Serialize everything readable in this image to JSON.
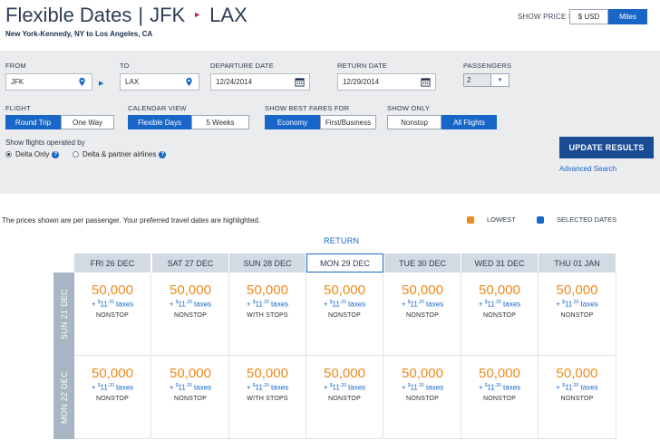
{
  "header": {
    "title_a": "Flexible Dates",
    "title_sep": "|",
    "origin": "JFK",
    "destination": "LAX",
    "route": "New York-Kennedy, NY to Los Angeles, CA",
    "show_price_in": "SHOW PRICE IN",
    "usd_label": "$ USD",
    "miles_label": "Miles"
  },
  "search": {
    "from_label": "FROM",
    "from_value": "JFK",
    "to_label": "TO",
    "to_value": "LAX",
    "depart_label": "DEPARTURE DATE",
    "depart_value": "12/24/2014",
    "return_label": "RETURN DATE",
    "return_value": "12/29/2014",
    "passengers_label": "PASSENGERS",
    "passengers_value": "2",
    "flight_label": "FLIGHT",
    "flight_opts": [
      "Round Trip",
      "One Way"
    ],
    "calendar_label": "CALENDAR VIEW",
    "calendar_opts": [
      "Flexible Days",
      "5 Weeks"
    ],
    "fares_label": "SHOW BEST FARES FOR",
    "fares_opts": [
      "Economy",
      "First/Business"
    ],
    "only_label": "SHOW ONLY",
    "only_opts": [
      "Nonstop",
      "All Flights"
    ],
    "operated_label": "Show flights operated by",
    "op_delta": "Delta Only",
    "op_partner": "Delta & partner airlines",
    "update_btn": "UPDATE RESULTS",
    "advanced": "Advanced Search"
  },
  "info": {
    "note": "The prices shown are per passenger. Your preferred travel dates are highlighted.",
    "lowest": "LOWEST",
    "selected": "SELECTED DATES",
    "return_hdr": "RETURN",
    "colors": {
      "lowest": "#f08a1e",
      "selected": "#1866c7"
    }
  },
  "grid": {
    "columns": [
      "FRI 26 DEC",
      "SAT 27 DEC",
      "SUN 28 DEC",
      "MON 29 DEC",
      "TUE 30 DEC",
      "WED 31 DEC",
      "THU 01 JAN"
    ],
    "rows": [
      {
        "label": "SUN 21 DEC",
        "cells": [
          {
            "price": "50,000",
            "tax_sym": "$",
            "tax_int": "11",
            "tax_dec": ".20",
            "tax_word": "taxes",
            "stops": "NONSTOP"
          },
          {
            "price": "50,000",
            "tax_sym": "$",
            "tax_int": "11",
            "tax_dec": ".20",
            "tax_word": "taxes",
            "stops": "NONSTOP"
          },
          {
            "price": "50,000",
            "tax_sym": "$",
            "tax_int": "11",
            "tax_dec": ".20",
            "tax_word": "taxes",
            "stops": "WITH STOPS"
          },
          {
            "price": "50,000",
            "tax_sym": "$",
            "tax_int": "11",
            "tax_dec": ".20",
            "tax_word": "taxes",
            "stops": "NONSTOP"
          },
          {
            "price": "50,000",
            "tax_sym": "$",
            "tax_int": "11",
            "tax_dec": ".20",
            "tax_word": "taxes",
            "stops": "NONSTOP"
          },
          {
            "price": "50,000",
            "tax_sym": "$",
            "tax_int": "11",
            "tax_dec": ".20",
            "tax_word": "taxes",
            "stops": "NONSTOP"
          },
          {
            "price": "50,000",
            "tax_sym": "$",
            "tax_int": "11",
            "tax_dec": ".20",
            "tax_word": "taxes",
            "stops": "NONSTOP"
          }
        ]
      },
      {
        "label": "MON 22 DEC",
        "cells": [
          {
            "price": "50,000",
            "tax_sym": "$",
            "tax_int": "11",
            "tax_dec": ".20",
            "tax_word": "taxes",
            "stops": "NONSTOP"
          },
          {
            "price": "50,000",
            "tax_sym": "$",
            "tax_int": "11",
            "tax_dec": ".20",
            "tax_word": "taxes",
            "stops": "NONSTOP"
          },
          {
            "price": "50,000",
            "tax_sym": "$",
            "tax_int": "11",
            "tax_dec": ".20",
            "tax_word": "taxes",
            "stops": "WITH STOPS"
          },
          {
            "price": "50,000",
            "tax_sym": "$",
            "tax_int": "11",
            "tax_dec": ".20",
            "tax_word": "taxes",
            "stops": "NONSTOP"
          },
          {
            "price": "50,000",
            "tax_sym": "$",
            "tax_int": "11",
            "tax_dec": ".20",
            "tax_word": "taxes",
            "stops": "NONSTOP"
          },
          {
            "price": "50,000",
            "tax_sym": "$",
            "tax_int": "11",
            "tax_dec": ".20",
            "tax_word": "taxes",
            "stops": "NONSTOP"
          },
          {
            "price": "50,000",
            "tax_sym": "$",
            "tax_int": "11",
            "tax_dec": ".20",
            "tax_word": "taxes",
            "stops": "NONSTOP"
          }
        ]
      }
    ]
  }
}
